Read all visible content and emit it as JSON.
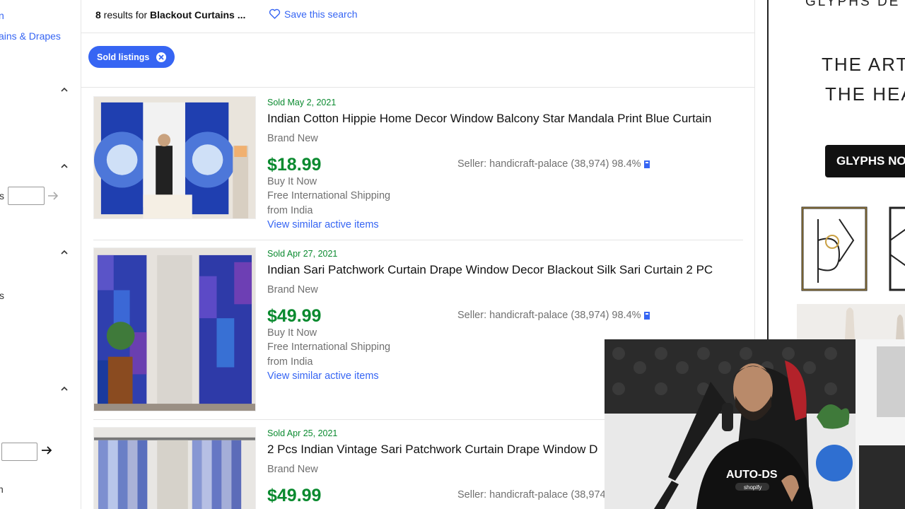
{
  "sidebar": {
    "link_top": "n",
    "link_category": "ains & Drapes",
    "price_label_fragment": "s",
    "filter_label_fragment": "s",
    "bottom_fragment": "n"
  },
  "header": {
    "results_count": "8",
    "results_text": " results for ",
    "query": "Blackout Curtains ...",
    "save_search": "Save this search"
  },
  "filters": {
    "chip_label": "Sold listings"
  },
  "listings": [
    {
      "sold_date": "Sold May 2, 2021",
      "title": "Indian Cotton Hippie Home Decor Window Balcony Star Mandala Print Blue Curtain",
      "condition": "Brand New",
      "price": "$18.99",
      "format": "Buy It Now",
      "shipping": "Free International Shipping",
      "location": "from India",
      "similar": "View similar active items",
      "seller": "Seller: handicraft-palace (38,974) 98.4%"
    },
    {
      "sold_date": "Sold Apr 27, 2021",
      "title": "Indian Sari Patchwork Curtain Drape Window Decor Blackout Silk Sari Curtain 2 PC",
      "condition": "Brand New",
      "price": "$49.99",
      "format": "Buy It Now",
      "shipping": "Free International Shipping",
      "location": "from India",
      "similar": "View similar active items",
      "seller": "Seller: handicraft-palace (38,974) 98.4%"
    },
    {
      "sold_date": "Sold Apr 25, 2021",
      "title": "2 Pcs Indian Vintage Sari Patchwork Curtain Drape Window D",
      "condition": "Brand New",
      "price": "$49.99",
      "seller": "Seller: handicraft-palace (38,974"
    }
  ],
  "ad": {
    "brand": "GLYPHS DE",
    "headline_1": "THE ART C",
    "headline_2": "THE HEA",
    "cta": "GLYPHS NO"
  },
  "webcam": {
    "shirt_text": "AUTO-DS",
    "shirt_sub": "shopify"
  },
  "colors": {
    "link": "#3665f3",
    "sold_green": "#0a8a2f",
    "muted": "#707070"
  }
}
